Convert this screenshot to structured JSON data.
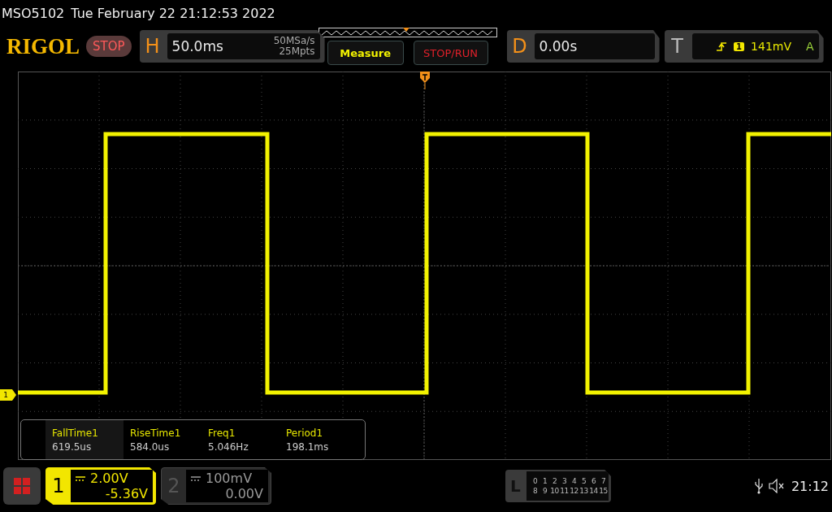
{
  "status_line": {
    "model": "MSO5102",
    "datetime": "Tue February 22 21:12:53 2022"
  },
  "header": {
    "logo": "RIGOL",
    "run_state": "STOP",
    "horizontal": {
      "label": "H",
      "timebase": "50.0ms",
      "sample_rate": "50MSa/s",
      "memory_depth": "25Mpts"
    },
    "buttons": [
      {
        "label": "Measure",
        "kind": "measure"
      },
      {
        "label": "STOP/RUN",
        "kind": "stoprun"
      }
    ],
    "delay": {
      "label": "D",
      "value": "0.00s"
    },
    "trigger": {
      "label": "T",
      "source": "1",
      "level": "141mV",
      "mode": "A"
    }
  },
  "display": {
    "channel_marker": "1",
    "measurements": [
      {
        "name": "FallTime1",
        "value": "619.5us",
        "selected": true
      },
      {
        "name": "RiseTime1",
        "value": "584.0us",
        "selected": false
      },
      {
        "name": "Freq1",
        "value": "5.046Hz",
        "selected": false
      },
      {
        "name": "Period1",
        "value": "198.1ms",
        "selected": false
      }
    ]
  },
  "channels": [
    {
      "number": "1",
      "scale": "2.00V",
      "offset": "-5.36V",
      "selected": true
    },
    {
      "number": "2",
      "scale": "100mV",
      "offset": "0.00V",
      "selected": false
    }
  ],
  "logic": {
    "label": "L",
    "rows": [
      [
        "0",
        "1",
        "2",
        "3",
        "4",
        "5",
        "6",
        "7"
      ],
      [
        "8",
        "9",
        "10",
        "11",
        "12",
        "13",
        "14",
        "15"
      ]
    ]
  },
  "clock": "21:12"
}
